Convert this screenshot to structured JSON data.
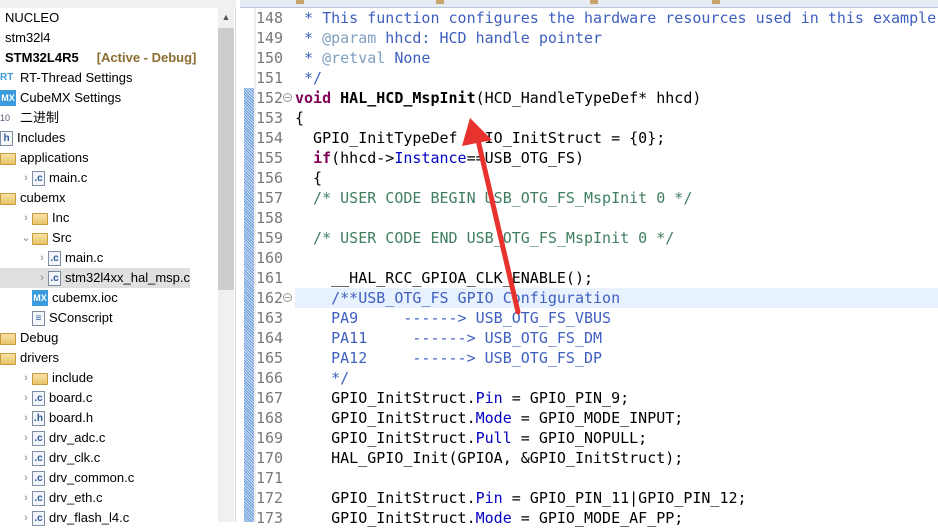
{
  "sidebar": {
    "items": [
      {
        "label": "NUCLEO",
        "icon": "none",
        "indent": 0
      },
      {
        "label": "stm32l4",
        "icon": "none",
        "indent": 0
      },
      {
        "label": "STM32L4R5",
        "icon": "none",
        "indent": 0,
        "bold": true,
        "suffix": "[Active - Debug]"
      },
      {
        "label": "RT-Thread Settings",
        "icon": "rt-thread-icon",
        "indent": 0
      },
      {
        "label": "CubeMX Settings",
        "icon": "cubemx-icon",
        "indent": 0
      },
      {
        "label": "二进制",
        "icon": "binary-icon",
        "indent": 0
      },
      {
        "label": "Includes",
        "icon": "includes-icon",
        "indent": 0
      },
      {
        "label": "applications",
        "icon": "folder-icon",
        "indent": 0
      },
      {
        "label": "main.c",
        "icon": "c-file-icon",
        "indent": 1,
        "chevron": "right"
      },
      {
        "label": "cubemx",
        "icon": "folder-icon",
        "indent": 0
      },
      {
        "label": "Inc",
        "icon": "folder-icon",
        "indent": 1,
        "chevron": "right"
      },
      {
        "label": "Src",
        "icon": "folder-icon",
        "indent": 1,
        "chevron": "down"
      },
      {
        "label": "main.c",
        "icon": "c-file-icon",
        "indent": 2,
        "chevron": "right"
      },
      {
        "label": "stm32l4xx_hal_msp.c",
        "icon": "c-file-icon",
        "indent": 2,
        "chevron": "right",
        "selected": true
      },
      {
        "label": "cubemx.ioc",
        "icon": "cubemx-icon",
        "indent": 1
      },
      {
        "label": "SConscript",
        "icon": "text-file-icon",
        "indent": 1
      },
      {
        "label": "Debug",
        "icon": "folder-icon",
        "indent": 0
      },
      {
        "label": "drivers",
        "icon": "folder-icon",
        "indent": 0
      },
      {
        "label": "include",
        "icon": "folder-icon",
        "indent": 1,
        "chevron": "right"
      },
      {
        "label": "board.c",
        "icon": "c-file-icon",
        "indent": 1,
        "chevron": "right"
      },
      {
        "label": "board.h",
        "icon": "h-file-icon",
        "indent": 1,
        "chevron": "right"
      },
      {
        "label": "drv_adc.c",
        "icon": "c-file-icon",
        "indent": 1,
        "chevron": "right"
      },
      {
        "label": "drv_clk.c",
        "icon": "c-file-icon",
        "indent": 1,
        "chevron": "right"
      },
      {
        "label": "drv_common.c",
        "icon": "c-file-icon",
        "indent": 1,
        "chevron": "right"
      },
      {
        "label": "drv_eth.c",
        "icon": "c-file-icon",
        "indent": 1,
        "chevron": "right"
      },
      {
        "label": "drv_flash_l4.c",
        "icon": "c-file-icon",
        "indent": 1,
        "chevron": "right"
      }
    ]
  },
  "editor": {
    "highlight_line": "162",
    "lines": [
      {
        "n": "148",
        "t": [
          [
            " * This function configures the hardware resources used in this example",
            "doc"
          ]
        ]
      },
      {
        "n": "149",
        "t": [
          [
            " * ",
            "doc"
          ],
          [
            "@param",
            "tag"
          ],
          [
            " hhcd: HCD handle pointer",
            "doc"
          ]
        ]
      },
      {
        "n": "150",
        "t": [
          [
            " * ",
            "doc"
          ],
          [
            "@retval",
            "tag"
          ],
          [
            " None",
            "doc"
          ]
        ]
      },
      {
        "n": "151",
        "t": [
          [
            " */",
            "doc"
          ]
        ]
      },
      {
        "n": "152",
        "fold": true,
        "t": [
          [
            "void",
            "kw"
          ],
          [
            " ",
            "pl"
          ],
          [
            "HAL_HCD_MspInit",
            "fn"
          ],
          [
            "(HCD_HandleTypeDef* hhcd)",
            "pl"
          ]
        ]
      },
      {
        "n": "153",
        "t": [
          [
            "{",
            "pl"
          ]
        ]
      },
      {
        "n": "154",
        "t": [
          [
            "  GPIO_InitTypeDef GPIO_InitStruct = {0};",
            "pl"
          ]
        ]
      },
      {
        "n": "155",
        "t": [
          [
            "  ",
            "pl"
          ],
          [
            "if",
            "kw"
          ],
          [
            "(hhcd->",
            "pl"
          ],
          [
            "Instance",
            "field"
          ],
          [
            "==USB_OTG_FS)",
            "pl"
          ]
        ]
      },
      {
        "n": "156",
        "t": [
          [
            "  {",
            "pl"
          ]
        ]
      },
      {
        "n": "157",
        "t": [
          [
            "  /* USER CODE BEGIN USB_OTG_FS_MspInit 0 */",
            "cm"
          ]
        ]
      },
      {
        "n": "158",
        "t": []
      },
      {
        "n": "159",
        "t": [
          [
            "  /* USER CODE END USB_OTG_FS_MspInit 0 */",
            "cm"
          ]
        ]
      },
      {
        "n": "160",
        "t": []
      },
      {
        "n": "161",
        "t": [
          [
            "    __HAL_RCC_GPIOA_CLK_ENABLE();",
            "pl"
          ]
        ]
      },
      {
        "n": "162",
        "fold": true,
        "t": [
          [
            "    /**USB_OTG_FS GPIO Configuration",
            "doc"
          ]
        ]
      },
      {
        "n": "163",
        "t": [
          [
            "    PA9     ------> USB_OTG_FS_VBUS",
            "doc"
          ]
        ]
      },
      {
        "n": "164",
        "t": [
          [
            "    PA11     ------> USB_OTG_FS_DM",
            "doc"
          ]
        ]
      },
      {
        "n": "165",
        "t": [
          [
            "    PA12     ------> USB_OTG_FS_DP",
            "doc"
          ]
        ]
      },
      {
        "n": "166",
        "t": [
          [
            "    */",
            "doc"
          ]
        ]
      },
      {
        "n": "167",
        "t": [
          [
            "    GPIO_InitStruct.",
            "pl"
          ],
          [
            "Pin",
            "field"
          ],
          [
            " = GPIO_PIN_9;",
            "pl"
          ]
        ]
      },
      {
        "n": "168",
        "t": [
          [
            "    GPIO_InitStruct.",
            "pl"
          ],
          [
            "Mode",
            "field"
          ],
          [
            " = GPIO_MODE_INPUT;",
            "pl"
          ]
        ]
      },
      {
        "n": "169",
        "t": [
          [
            "    GPIO_InitStruct.",
            "pl"
          ],
          [
            "Pull",
            "field"
          ],
          [
            " = GPIO_NOPULL;",
            "pl"
          ]
        ]
      },
      {
        "n": "170",
        "t": [
          [
            "    HAL_GPIO_Init(GPIOA, &GPIO_InitStruct);",
            "pl"
          ]
        ]
      },
      {
        "n": "171",
        "t": []
      },
      {
        "n": "172",
        "t": [
          [
            "    GPIO_InitStruct.",
            "pl"
          ],
          [
            "Pin",
            "field"
          ],
          [
            " = GPIO_PIN_11|GPIO_PIN_12;",
            "pl"
          ]
        ]
      },
      {
        "n": "173",
        "t": [
          [
            "    GPIO_InitStruct.",
            "pl"
          ],
          [
            "Mode",
            "field"
          ],
          [
            " = GPIO_MODE_AF_PP;",
            "pl"
          ]
        ]
      }
    ]
  },
  "annotation": {
    "type": "arrow",
    "color": "#e8322e"
  },
  "colors": {
    "keyword": "#7f0055",
    "field": "#0000c0",
    "doc_comment": "#3f5fbf",
    "comment": "#3f7f5f",
    "highlight": "#e8f2fe"
  }
}
